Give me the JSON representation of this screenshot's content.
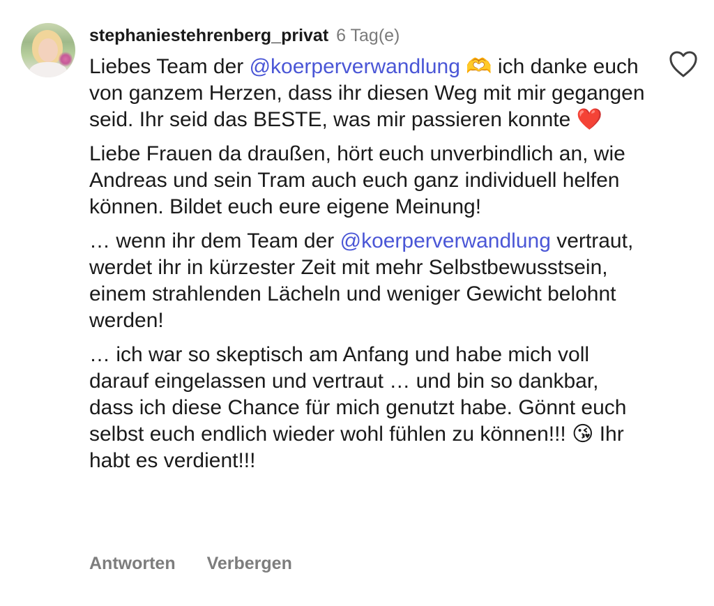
{
  "comment": {
    "username": "stephaniestehrenberg_privat",
    "timestamp": "6 Tag(e)",
    "paragraphs": [
      {
        "parts": [
          {
            "type": "text",
            "value": "Liebes Team der "
          },
          {
            "type": "mention",
            "value": "@koerperverwandlung"
          },
          {
            "type": "text",
            "value": " 🫶 ich danke euch von ganzem Herzen, dass ihr diesen Weg mit mir gegangen seid. Ihr seid das BESTE, was mir passieren konnte ❤️"
          }
        ]
      },
      {
        "parts": [
          {
            "type": "text",
            "value": "Liebe Frauen da draußen, hört euch unverbindlich an, wie Andreas und sein Tram auch euch ganz individuell helfen können. Bildet euch eure eigene Meinung!"
          }
        ]
      },
      {
        "parts": [
          {
            "type": "text",
            "value": "… wenn ihr dem Team der "
          },
          {
            "type": "mention",
            "value": "@koerperverwandlung"
          },
          {
            "type": "text",
            "value": " vertraut, werdet ihr in kürzester Zeit mit mehr Selbstbewusstsein, einem strahlenden Lächeln und weniger Gewicht belohnt werden!"
          }
        ]
      },
      {
        "parts": [
          {
            "type": "text",
            "value": "… ich war so skeptisch am Anfang und habe mich voll darauf eingelassen und vertraut … und bin so dankbar, dass ich diese Chance für mich genutzt habe. Gönnt euch selbst euch endlich wieder wohl fühlen zu können!!! 😘 Ihr habt es verdient!!!"
          }
        ]
      }
    ]
  },
  "actions": {
    "reply_label": "Antworten",
    "hide_label": "Verbergen"
  },
  "icons": {
    "like": "heart-icon",
    "avatar": "avatar"
  },
  "colors": {
    "mention": "#4a56d6",
    "secondary_text": "#7d7d7d",
    "text": "#1a1a1a"
  }
}
